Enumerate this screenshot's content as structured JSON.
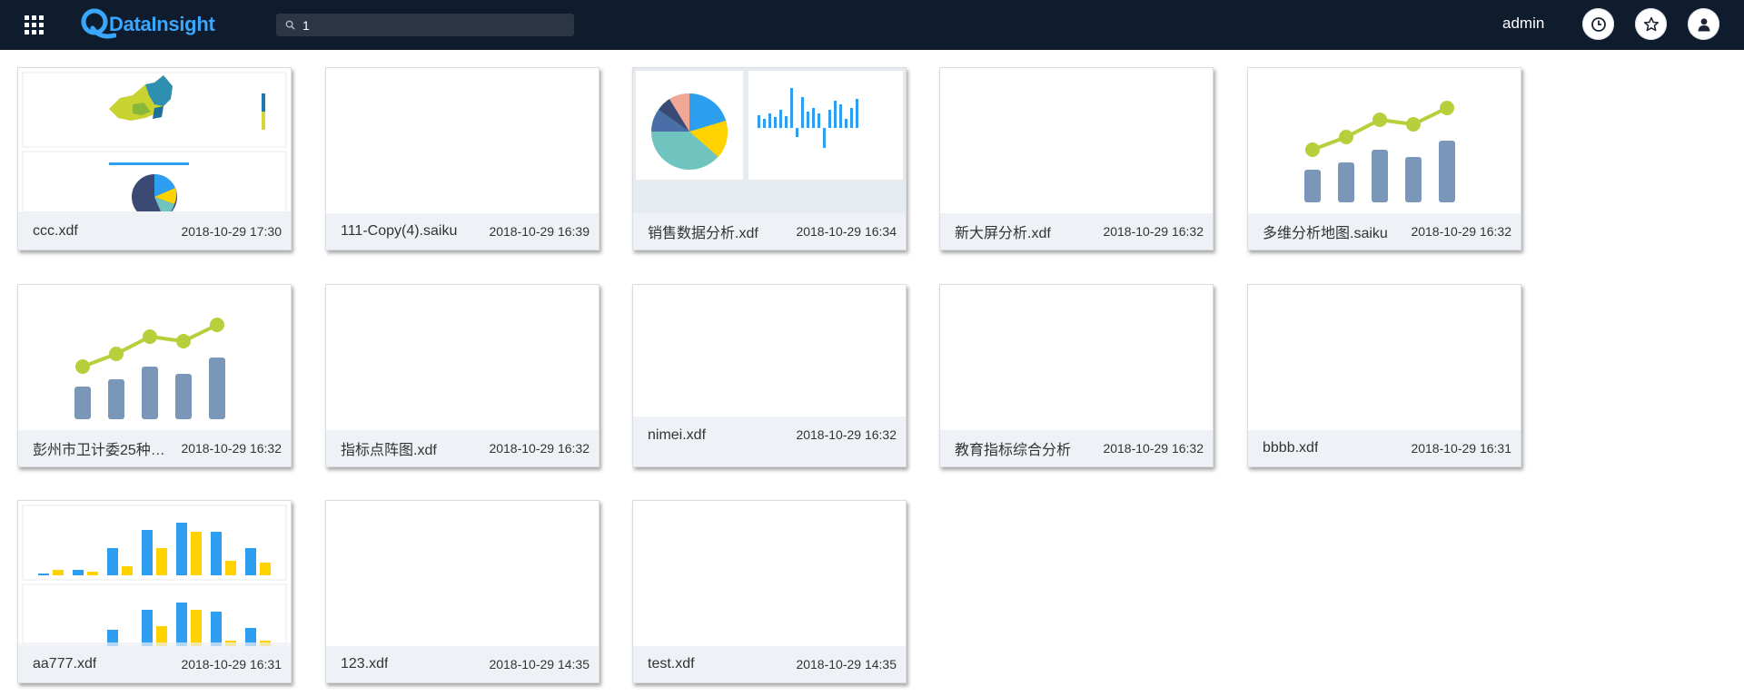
{
  "header": {
    "logo_text": "DataInsight",
    "search_value": "1",
    "user_name": "admin",
    "icons": [
      "apps-grid-icon",
      "search-icon",
      "clock-icon",
      "star-icon",
      "user-icon"
    ]
  },
  "colors": {
    "topbar": "#0f1c2e",
    "accent": "#3aa7ff",
    "bar_gray_blue": "#7a96b8",
    "line_green": "#b7cf3b",
    "chart_blue": "#2d9ef0",
    "chart_yellow": "#ffd200",
    "caption_bg": "#eef1f5"
  },
  "files": [
    {
      "name": "ccc.xdf",
      "date": "2018-10-29 17:30",
      "thumbnail": "map-and-pie"
    },
    {
      "name": "111-Copy(4).saiku",
      "date": "2018-10-29 16:39",
      "thumbnail": "blank"
    },
    {
      "name": "销售数据分析.xdf",
      "date": "2018-10-29 16:34",
      "thumbnail": "pie-and-bar"
    },
    {
      "name": "新大屏分析.xdf",
      "date": "2018-10-29 16:32",
      "thumbnail": "blank"
    },
    {
      "name": "多维分析地图.saiku",
      "date": "2018-10-29 16:32",
      "thumbnail": "bar-line"
    },
    {
      "name": "彭州市卫计委25种…",
      "date": "2018-10-29 16:32",
      "thumbnail": "bar-line"
    },
    {
      "name": "指标点阵图.xdf",
      "date": "2018-10-29 16:32",
      "thumbnail": "blank"
    },
    {
      "name": "nimei.xdf",
      "date": "2018-10-29 16:32",
      "thumbnail": "blank"
    },
    {
      "name": "教育指标综合分析",
      "date": "2018-10-29 16:32",
      "thumbnail": "blank"
    },
    {
      "name": "bbbb.xdf",
      "date": "2018-10-29 16:31",
      "thumbnail": "blank"
    },
    {
      "name": "aa777.xdf",
      "date": "2018-10-29 16:31",
      "thumbnail": "double-bar"
    },
    {
      "name": "123.xdf",
      "date": "2018-10-29 14:35",
      "thumbnail": "blank"
    },
    {
      "name": "test.xdf",
      "date": "2018-10-29 14:35",
      "thumbnail": "blank"
    }
  ]
}
